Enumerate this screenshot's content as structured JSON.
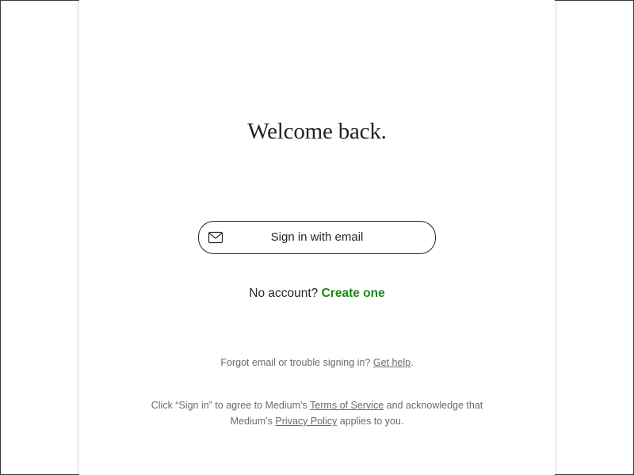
{
  "modal": {
    "title": "Welcome back.",
    "email_button_label": "Sign in with email",
    "email_icon": "mail-icon",
    "signup": {
      "prompt": "No account?",
      "link": "Create one"
    },
    "help": {
      "text": "Forgot email or trouble signing in?",
      "link": "Get help",
      "suffix": "."
    },
    "legal": {
      "part1": "Click “Sign in” to agree to Medium’s",
      "terms_link": "Terms of Service",
      "part2": "and acknowledge that Medium’s",
      "privacy_link": "Privacy Policy",
      "part3": "applies to you."
    }
  },
  "colors": {
    "text_primary": "#242424",
    "text_secondary": "#6b6b6b",
    "accent_green": "#1a8917",
    "background": "#ffffff"
  }
}
